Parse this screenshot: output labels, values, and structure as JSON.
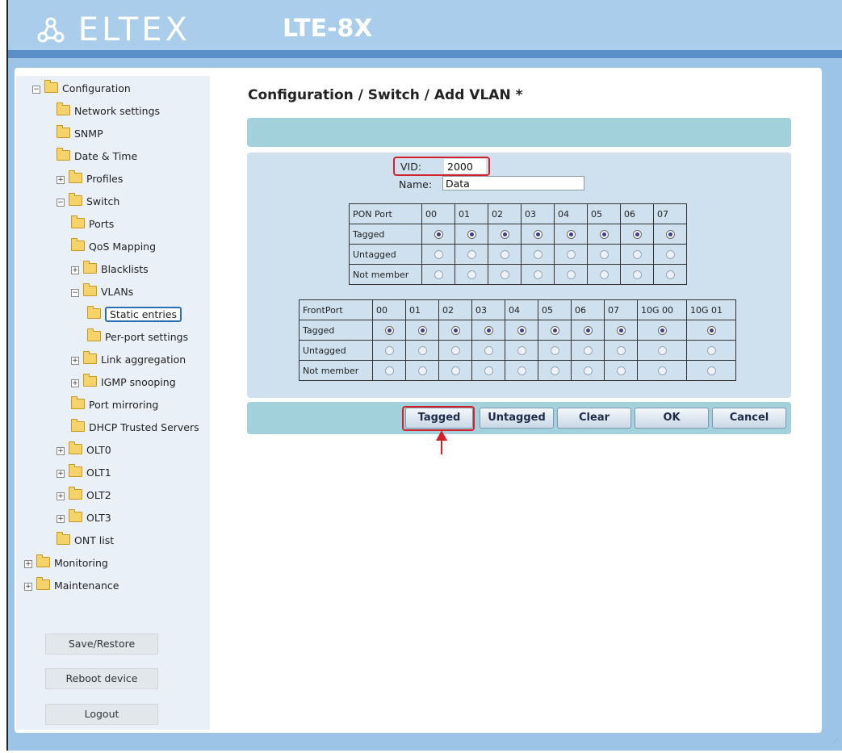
{
  "header": {
    "brand": "ELTEX",
    "model": "LTE-8X"
  },
  "sidebar": {
    "tree": [
      {
        "label": "Configuration",
        "expander": "⊟"
      },
      {
        "label": "Network settings"
      },
      {
        "label": "SNMP"
      },
      {
        "label": "Date & Time"
      },
      {
        "label": "Profiles",
        "expander": "⊞"
      },
      {
        "label": "Switch",
        "expander": "⊟"
      },
      {
        "label": "Ports"
      },
      {
        "label": "QoS Mapping"
      },
      {
        "label": "Blacklists",
        "expander": "⊞"
      },
      {
        "label": "VLANs",
        "expander": "⊟"
      },
      {
        "label": "Static entries"
      },
      {
        "label": "Per-port settings"
      },
      {
        "label": "Link aggregation",
        "expander": "⊞"
      },
      {
        "label": "IGMP snooping",
        "expander": "⊞"
      },
      {
        "label": "Port mirroring"
      },
      {
        "label": "DHCP Trusted Servers"
      },
      {
        "label": "OLT0",
        "expander": "⊞"
      },
      {
        "label": "OLT1",
        "expander": "⊞"
      },
      {
        "label": "OLT2",
        "expander": "⊞"
      },
      {
        "label": "OLT3",
        "expander": "⊞"
      },
      {
        "label": "ONT list"
      },
      {
        "label": "Monitoring",
        "expander": "⊞"
      },
      {
        "label": "Maintenance",
        "expander": "⊞"
      }
    ],
    "buttons": {
      "save_restore": "Save/Restore",
      "reboot": "Reboot device",
      "logout": "Logout"
    }
  },
  "main": {
    "title": "Configuration / Switch / Add VLAN *",
    "vid_label": "VID:",
    "vid_value": "2000",
    "name_label": "Name:",
    "name_value": "Data",
    "pon_table": {
      "header": [
        "PON Port",
        "00",
        "01",
        "02",
        "03",
        "04",
        "05",
        "06",
        "07"
      ],
      "rows": [
        {
          "label": "Tagged",
          "selected": [
            true,
            true,
            true,
            true,
            true,
            true,
            true,
            true
          ]
        },
        {
          "label": "Untagged",
          "selected": [
            false,
            false,
            false,
            false,
            false,
            false,
            false,
            false
          ]
        },
        {
          "label": "Not member",
          "selected": [
            false,
            false,
            false,
            false,
            false,
            false,
            false,
            false
          ]
        }
      ]
    },
    "front_table": {
      "header": [
        "FrontPort",
        "00",
        "01",
        "02",
        "03",
        "04",
        "05",
        "06",
        "07",
        "10G 00",
        "10G 01"
      ],
      "rows": [
        {
          "label": "Tagged",
          "selected": [
            true,
            true,
            true,
            true,
            true,
            true,
            true,
            true,
            true,
            true
          ]
        },
        {
          "label": "Untagged",
          "selected": [
            false,
            false,
            false,
            false,
            false,
            false,
            false,
            false,
            false,
            false
          ]
        },
        {
          "label": "Not member",
          "selected": [
            false,
            false,
            false,
            false,
            false,
            false,
            false,
            false,
            false,
            false
          ]
        }
      ]
    },
    "buttons": {
      "tagged": "Tagged",
      "untagged": "Untagged",
      "clear": "Clear",
      "ok": "OK",
      "cancel": "Cancel"
    }
  },
  "colors": {
    "highlight": "#d4202a",
    "accent": "#5b8fc7"
  },
  "icons": [
    "folder-icon",
    "expander-icon",
    "radio-icon",
    "arrow-icon"
  ]
}
